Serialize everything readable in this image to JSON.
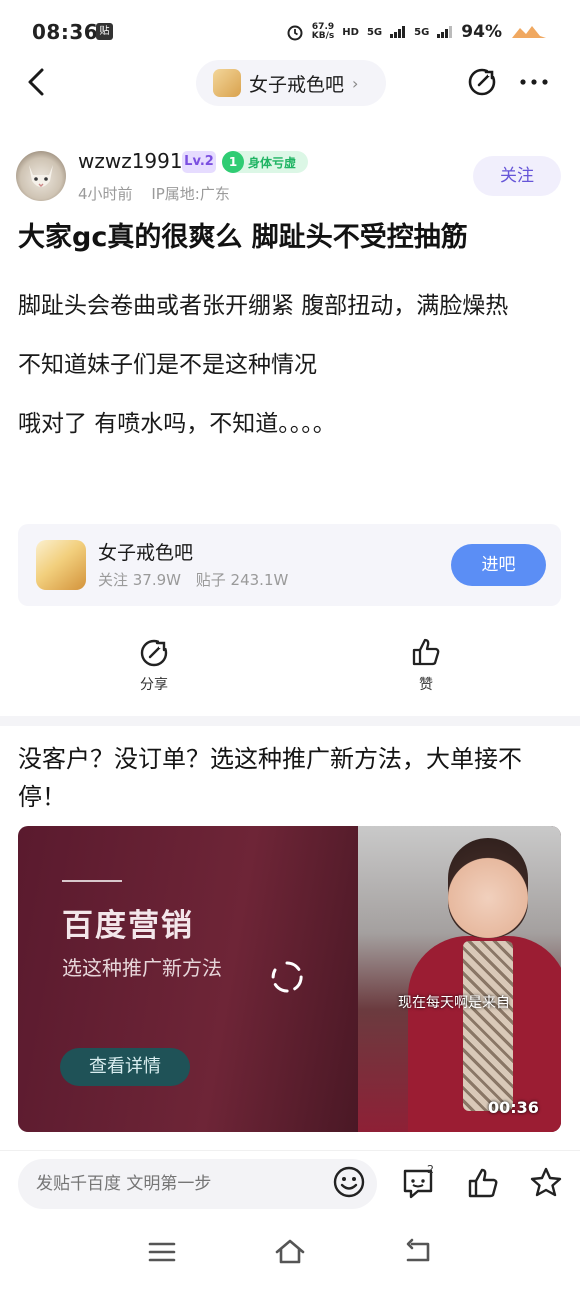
{
  "status_bar": {
    "time": "08:36",
    "notification_badge": "贴",
    "net_speed_top": "67.9",
    "net_speed_unit": "KB/s",
    "hd_tag": "HD",
    "signal_1": "5G",
    "signal_2": "5G",
    "battery": "94%"
  },
  "nav": {
    "forum_name": "女子戒色吧",
    "forum_arrow": "›"
  },
  "author": {
    "username": "wzwz1991",
    "level": "Lv.2",
    "title_num": "1",
    "title_text": "身体亏虚",
    "time": "4小时前",
    "ip": "IP属地:广东",
    "follow_label": "关注"
  },
  "post": {
    "title": "大家gc真的很爽么 脚趾头不受控抽筋",
    "paragraphs": [
      "脚趾头会卷曲或者张开绷紧 腹部扭动，满脸燥热",
      "不知道妹子们是不是这种情况",
      "哦对了 有喷水吗，不知道。。。。"
    ]
  },
  "forum_card": {
    "name": "女子戒色吧",
    "followers": "关注 37.9W",
    "posts": "贴子 243.1W",
    "enter_label": "进吧"
  },
  "actions": {
    "share_label": "分享",
    "like_label": "赞"
  },
  "ad": {
    "title": "没客户？没订单？选这种推广新方法，大单接不停！",
    "brand": "百度营销",
    "subtitle": "选这种推广新方法",
    "detail_label": "查看详情",
    "caption": "现在每天啊是来自",
    "duration": "00:36"
  },
  "bottom_bar": {
    "input_placeholder": "发贴千百度 文明第一步",
    "comment_count": "2"
  },
  "colors": {
    "accent_blue": "#5b8ef5",
    "follow_purple": "#6655d8",
    "level_purple": "#7b4fe0",
    "badge_green": "#2fcc73"
  }
}
